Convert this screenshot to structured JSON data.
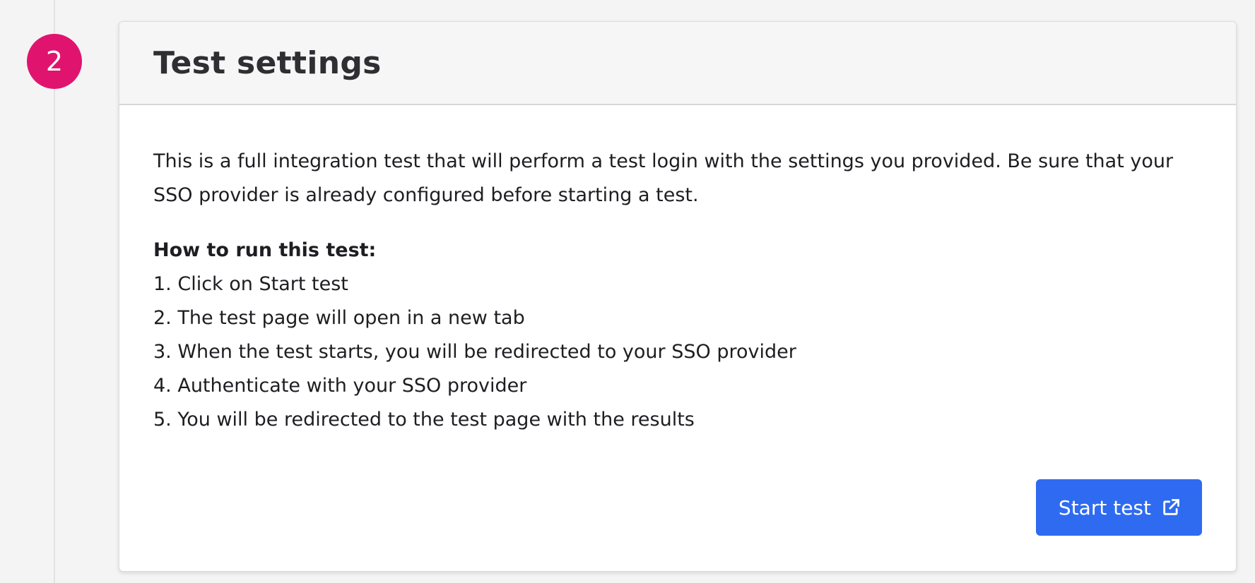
{
  "step": {
    "number": "2"
  },
  "card": {
    "title": "Test settings",
    "description": "This is a full integration test that will perform a test login with the settings you provided. Be sure that your SSO provider is already configured before starting a test.",
    "howto_title": "How to run this test:",
    "steps": [
      "1. Click on Start test",
      "2. The test page will open in a new tab",
      "3. When the test starts, you will be redirected to your SSO provider",
      "4. Authenticate with your SSO provider",
      "5. You will be redirected to the test page with the results"
    ],
    "button_label": "Start test",
    "button_icon": "external-link-icon"
  },
  "colors": {
    "badge": "#e0146e",
    "button": "#2f6bf0",
    "header_bg": "#f6f6f7",
    "page_bg": "#f4f4f5"
  }
}
